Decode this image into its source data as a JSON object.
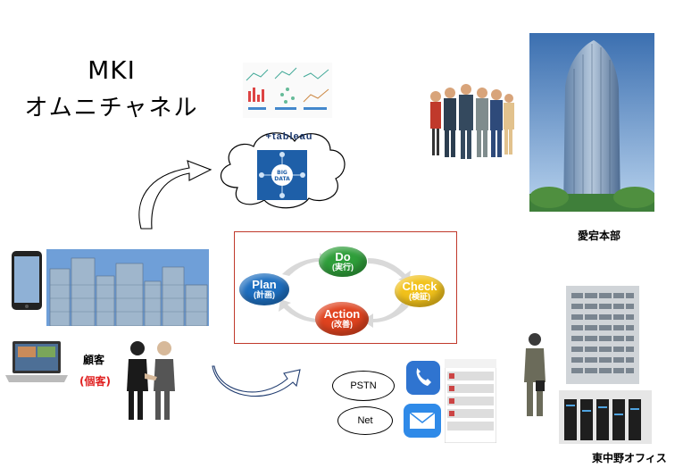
{
  "title": {
    "line1": "MKI",
    "line2": "オムニチャネル"
  },
  "cloud": {
    "brand": "+tableau",
    "big_data": "BIG DATA"
  },
  "pdca": {
    "plan": {
      "en": "Plan",
      "jp": "(計画)",
      "color": "#1e6fc0"
    },
    "do": {
      "en": "Do",
      "jp": "(実行)",
      "color": "#2f9e3a"
    },
    "check": {
      "en": "Check",
      "jp": "(検証)",
      "color": "#f2c21b"
    },
    "action": {
      "en": "Action",
      "jp": "(改善)",
      "color": "#e0431f"
    },
    "border_color": "#c0392b"
  },
  "labels": {
    "hq": "愛宕本部",
    "office": "東中野オフィス",
    "customer": "顧客",
    "customer_sub": "(個客)"
  },
  "channels": {
    "pstn": "PSTN",
    "net": "Net"
  },
  "icons": [
    "phone-icon",
    "mail-icon",
    "laptop-icon",
    "smartphone-icon"
  ]
}
